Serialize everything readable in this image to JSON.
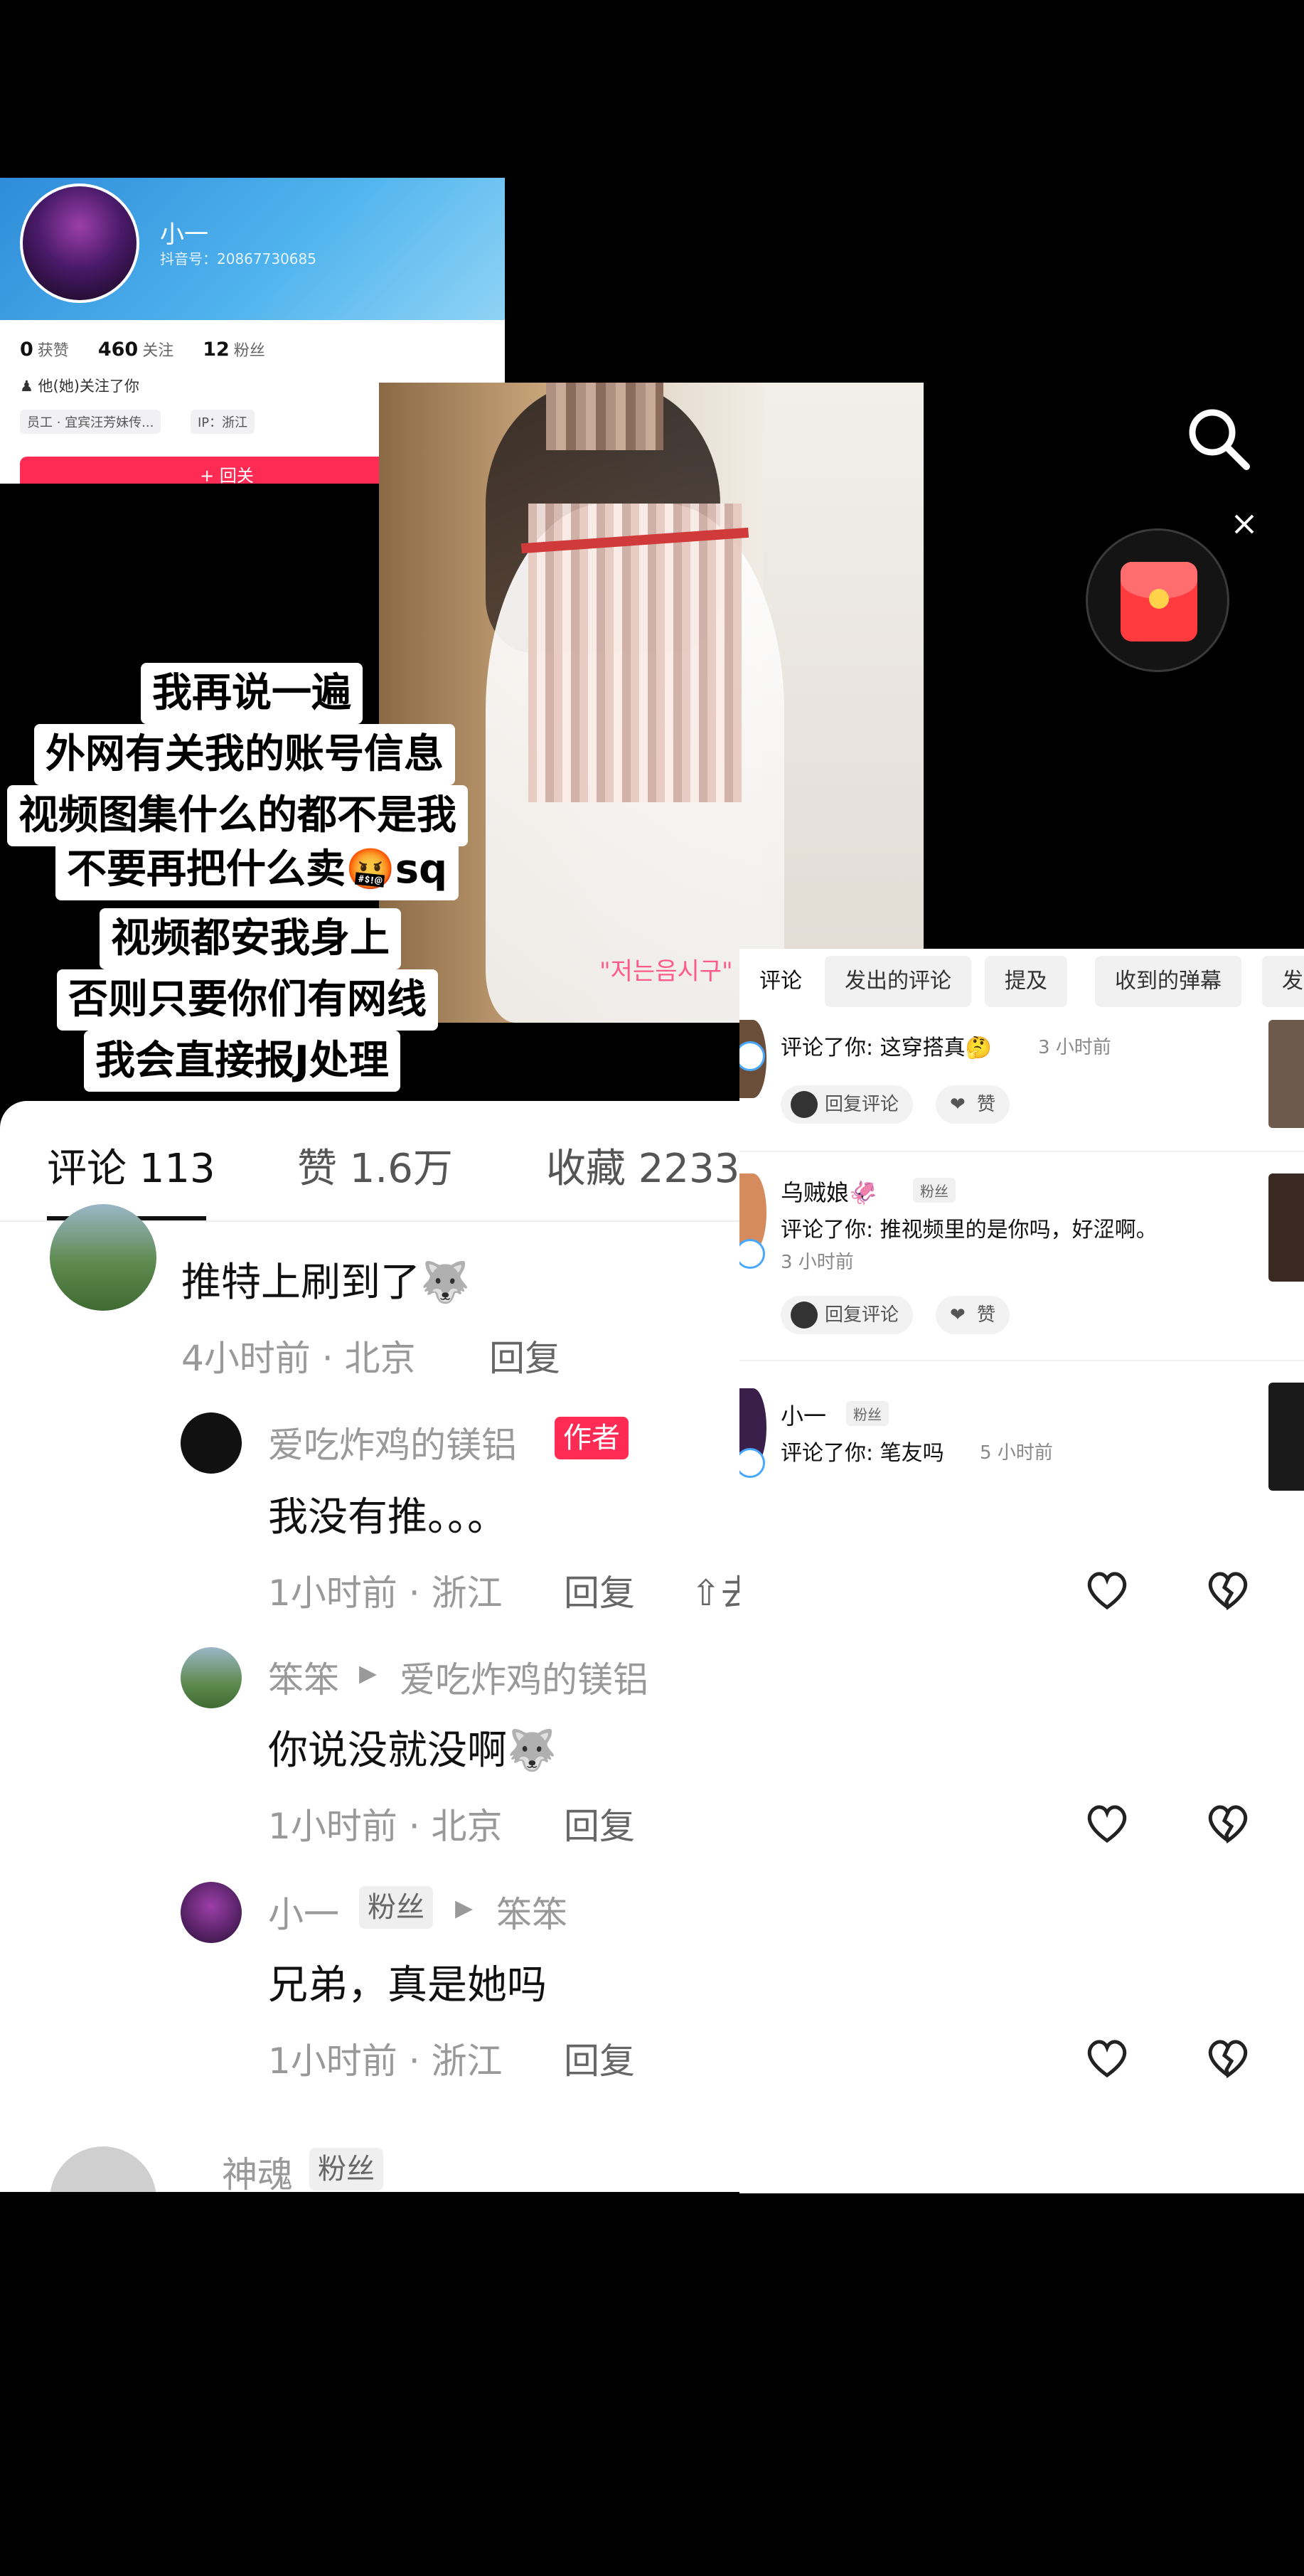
{
  "profile": {
    "nickname": "小一",
    "douyin_id": "抖音号：20867730685",
    "likes_count": "0",
    "likes_label": "获赞",
    "following_count": "460",
    "following_label": "关注",
    "fans_count": "12",
    "fans_label": "粉丝",
    "follows_you": "他(她)关注了你",
    "work_tag": "员工 · 宜宾汪芳妹传...",
    "ip_tag": "IP：浙江",
    "follow_back_button": "+ 回关",
    "more_button": "≡"
  },
  "photo": {
    "watermark": "\"저는음시구\""
  },
  "overlay_text": {
    "line1": "我再说一遍",
    "line2": "外网有关我的账号信息",
    "line3": "视频图集什么的都不是我",
    "line4": "不要再把什么卖🤬sq",
    "line5": "视频都安我身上",
    "line6": "否则只要你们有网线",
    "line7": "我会直接报J处理"
  },
  "notifications": {
    "tabs": [
      "评论",
      "发出的评论",
      "提及",
      "收到的弹幕",
      "发"
    ],
    "items": [
      {
        "name": "",
        "fan_tag": "",
        "text": "评论了你: 这穿搭真🤔",
        "time": "3 小时前",
        "reply_button": "回复评论",
        "like_button": "赞"
      },
      {
        "name": "乌贼娘🦑",
        "fan_tag": "粉丝",
        "text": "评论了你: 推视频里的是你吗，好涩啊。",
        "time": "3 小时前",
        "reply_button": "回复评论",
        "like_button": "赞"
      },
      {
        "name": "小一",
        "fan_tag": "粉丝",
        "text": "评论了你: 笔友吗",
        "time": "5 小时前"
      }
    ]
  },
  "comments": {
    "tabs": {
      "comments": "评论 113",
      "likes": "赞 1.6万",
      "favorites": "收藏 2233"
    },
    "threads": [
      {
        "user": "",
        "body": "推特上刷到了🐺",
        "meta": "4小时前 · 北京",
        "reply": "回复"
      },
      {
        "user": "爱吃炸鸡的镁铝",
        "author_tag": "作者",
        "body": "我没有推。。。",
        "meta": "1小时前 · 浙江",
        "reply": "回复",
        "publish": "去发布作品"
      },
      {
        "user": "笨笨",
        "reply_to": "爱吃炸鸡的镁铝",
        "body": "你说没就没啊🐺",
        "meta": "1小时前 · 北京",
        "reply": "回复"
      },
      {
        "user": "小一",
        "fan_tag": "粉丝",
        "reply_to": "笨笨",
        "body": "兄弟，真是她吗",
        "meta": "1小时前 · 浙江",
        "reply": "回复"
      },
      {
        "user": "神魂",
        "fan_tag": "粉丝"
      }
    ]
  },
  "colors": {
    "accent_red": "#fe2c55",
    "notification_badge": "#48a7ff"
  }
}
